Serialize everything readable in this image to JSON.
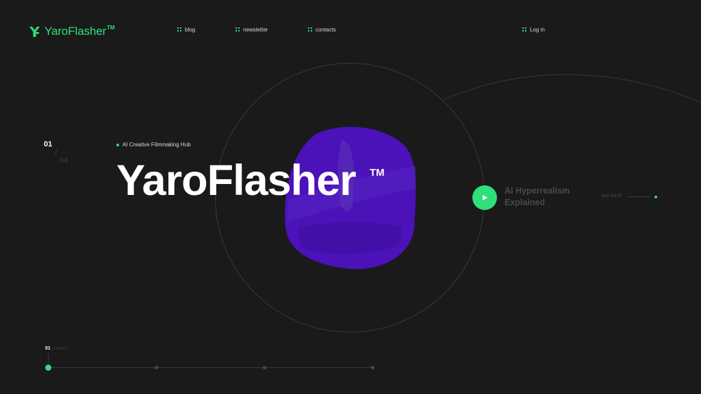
{
  "brand": {
    "name": "YaroFlasher",
    "tm": "TM",
    "icon": "yf-logo-icon",
    "accent": "#2fe07a"
  },
  "nav": {
    "icon": "grid-dots-icon",
    "items": [
      {
        "label": "blog"
      },
      {
        "label": "newsletter"
      },
      {
        "label": "contacts"
      }
    ],
    "login": "Log in"
  },
  "slider": {
    "current": "01",
    "separator": "/",
    "total": "04"
  },
  "hero": {
    "tag": "AI Creative Filmmaking Hub",
    "title": "YaroFlasher",
    "tm": "TM",
    "blob_color": "#4a12b8"
  },
  "video": {
    "title": "AI Hyperrealism Explained",
    "play_icon": "play-icon"
  },
  "scroll": {
    "hint": "just scroll"
  },
  "progress": {
    "current": "01",
    "label": "[ home ]",
    "steps": 4,
    "active_step": 1
  },
  "colors": {
    "background": "#1a1a1a",
    "accent": "#2fe07a",
    "blob": "#4a12b8"
  }
}
